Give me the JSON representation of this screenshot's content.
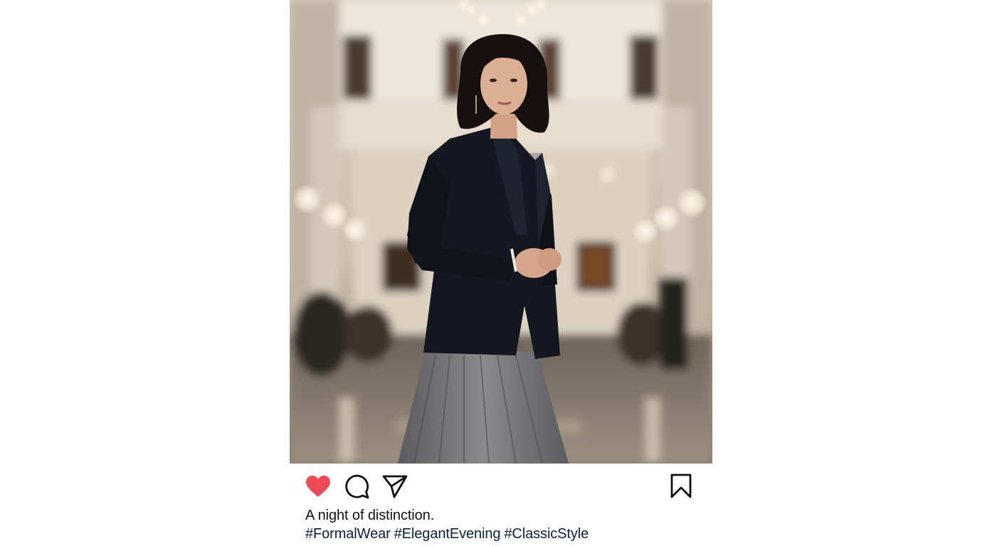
{
  "post": {
    "image_alt": "Woman in a black blazer and grey pleated skirt standing in a grand hall",
    "caption": "A night of distinction.",
    "hashtags": [
      "#FormalWear",
      "#ElegantEvening",
      "#ClassicStyle"
    ]
  },
  "actions": {
    "like": {
      "icon": "heart-icon",
      "state": "liked",
      "color": "#ed4956"
    },
    "comment": {
      "icon": "comment-bubble-icon"
    },
    "share": {
      "icon": "paper-plane-icon"
    },
    "save": {
      "icon": "bookmark-icon"
    }
  },
  "colors": {
    "like_red": "#ed4956",
    "icon_stroke": "#111111",
    "hashtag_navy": "#0b1f3a",
    "page_background": "#ffffff"
  }
}
